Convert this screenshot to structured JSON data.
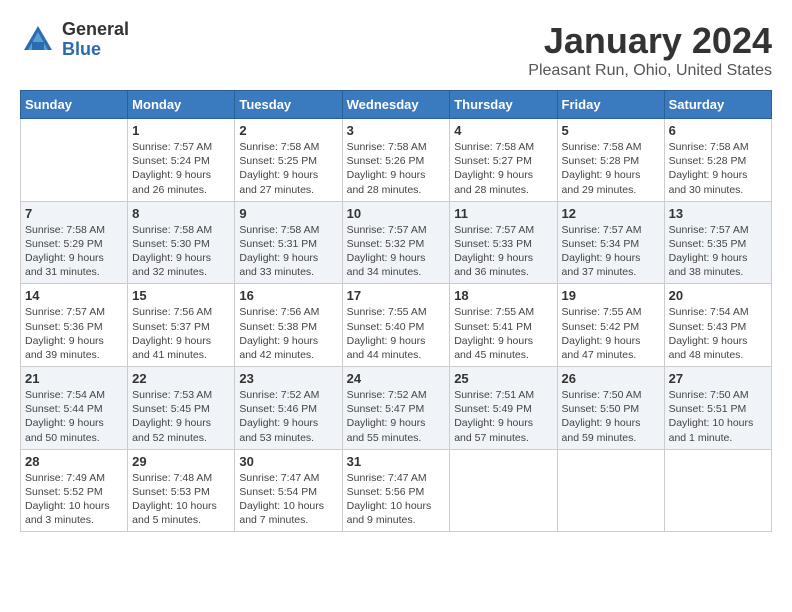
{
  "logo": {
    "general": "General",
    "blue": "Blue"
  },
  "title": "January 2024",
  "location": "Pleasant Run, Ohio, United States",
  "days_header": [
    "Sunday",
    "Monday",
    "Tuesday",
    "Wednesday",
    "Thursday",
    "Friday",
    "Saturday"
  ],
  "weeks": [
    [
      {
        "num": "",
        "info": ""
      },
      {
        "num": "1",
        "info": "Sunrise: 7:57 AM\nSunset: 5:24 PM\nDaylight: 9 hours\nand 26 minutes."
      },
      {
        "num": "2",
        "info": "Sunrise: 7:58 AM\nSunset: 5:25 PM\nDaylight: 9 hours\nand 27 minutes."
      },
      {
        "num": "3",
        "info": "Sunrise: 7:58 AM\nSunset: 5:26 PM\nDaylight: 9 hours\nand 28 minutes."
      },
      {
        "num": "4",
        "info": "Sunrise: 7:58 AM\nSunset: 5:27 PM\nDaylight: 9 hours\nand 28 minutes."
      },
      {
        "num": "5",
        "info": "Sunrise: 7:58 AM\nSunset: 5:28 PM\nDaylight: 9 hours\nand 29 minutes."
      },
      {
        "num": "6",
        "info": "Sunrise: 7:58 AM\nSunset: 5:28 PM\nDaylight: 9 hours\nand 30 minutes."
      }
    ],
    [
      {
        "num": "7",
        "info": "Sunrise: 7:58 AM\nSunset: 5:29 PM\nDaylight: 9 hours\nand 31 minutes."
      },
      {
        "num": "8",
        "info": "Sunrise: 7:58 AM\nSunset: 5:30 PM\nDaylight: 9 hours\nand 32 minutes."
      },
      {
        "num": "9",
        "info": "Sunrise: 7:58 AM\nSunset: 5:31 PM\nDaylight: 9 hours\nand 33 minutes."
      },
      {
        "num": "10",
        "info": "Sunrise: 7:57 AM\nSunset: 5:32 PM\nDaylight: 9 hours\nand 34 minutes."
      },
      {
        "num": "11",
        "info": "Sunrise: 7:57 AM\nSunset: 5:33 PM\nDaylight: 9 hours\nand 36 minutes."
      },
      {
        "num": "12",
        "info": "Sunrise: 7:57 AM\nSunset: 5:34 PM\nDaylight: 9 hours\nand 37 minutes."
      },
      {
        "num": "13",
        "info": "Sunrise: 7:57 AM\nSunset: 5:35 PM\nDaylight: 9 hours\nand 38 minutes."
      }
    ],
    [
      {
        "num": "14",
        "info": "Sunrise: 7:57 AM\nSunset: 5:36 PM\nDaylight: 9 hours\nand 39 minutes."
      },
      {
        "num": "15",
        "info": "Sunrise: 7:56 AM\nSunset: 5:37 PM\nDaylight: 9 hours\nand 41 minutes."
      },
      {
        "num": "16",
        "info": "Sunrise: 7:56 AM\nSunset: 5:38 PM\nDaylight: 9 hours\nand 42 minutes."
      },
      {
        "num": "17",
        "info": "Sunrise: 7:55 AM\nSunset: 5:40 PM\nDaylight: 9 hours\nand 44 minutes."
      },
      {
        "num": "18",
        "info": "Sunrise: 7:55 AM\nSunset: 5:41 PM\nDaylight: 9 hours\nand 45 minutes."
      },
      {
        "num": "19",
        "info": "Sunrise: 7:55 AM\nSunset: 5:42 PM\nDaylight: 9 hours\nand 47 minutes."
      },
      {
        "num": "20",
        "info": "Sunrise: 7:54 AM\nSunset: 5:43 PM\nDaylight: 9 hours\nand 48 minutes."
      }
    ],
    [
      {
        "num": "21",
        "info": "Sunrise: 7:54 AM\nSunset: 5:44 PM\nDaylight: 9 hours\nand 50 minutes."
      },
      {
        "num": "22",
        "info": "Sunrise: 7:53 AM\nSunset: 5:45 PM\nDaylight: 9 hours\nand 52 minutes."
      },
      {
        "num": "23",
        "info": "Sunrise: 7:52 AM\nSunset: 5:46 PM\nDaylight: 9 hours\nand 53 minutes."
      },
      {
        "num": "24",
        "info": "Sunrise: 7:52 AM\nSunset: 5:47 PM\nDaylight: 9 hours\nand 55 minutes."
      },
      {
        "num": "25",
        "info": "Sunrise: 7:51 AM\nSunset: 5:49 PM\nDaylight: 9 hours\nand 57 minutes."
      },
      {
        "num": "26",
        "info": "Sunrise: 7:50 AM\nSunset: 5:50 PM\nDaylight: 9 hours\nand 59 minutes."
      },
      {
        "num": "27",
        "info": "Sunrise: 7:50 AM\nSunset: 5:51 PM\nDaylight: 10 hours\nand 1 minute."
      }
    ],
    [
      {
        "num": "28",
        "info": "Sunrise: 7:49 AM\nSunset: 5:52 PM\nDaylight: 10 hours\nand 3 minutes."
      },
      {
        "num": "29",
        "info": "Sunrise: 7:48 AM\nSunset: 5:53 PM\nDaylight: 10 hours\nand 5 minutes."
      },
      {
        "num": "30",
        "info": "Sunrise: 7:47 AM\nSunset: 5:54 PM\nDaylight: 10 hours\nand 7 minutes."
      },
      {
        "num": "31",
        "info": "Sunrise: 7:47 AM\nSunset: 5:56 PM\nDaylight: 10 hours\nand 9 minutes."
      },
      {
        "num": "",
        "info": ""
      },
      {
        "num": "",
        "info": ""
      },
      {
        "num": "",
        "info": ""
      }
    ]
  ]
}
